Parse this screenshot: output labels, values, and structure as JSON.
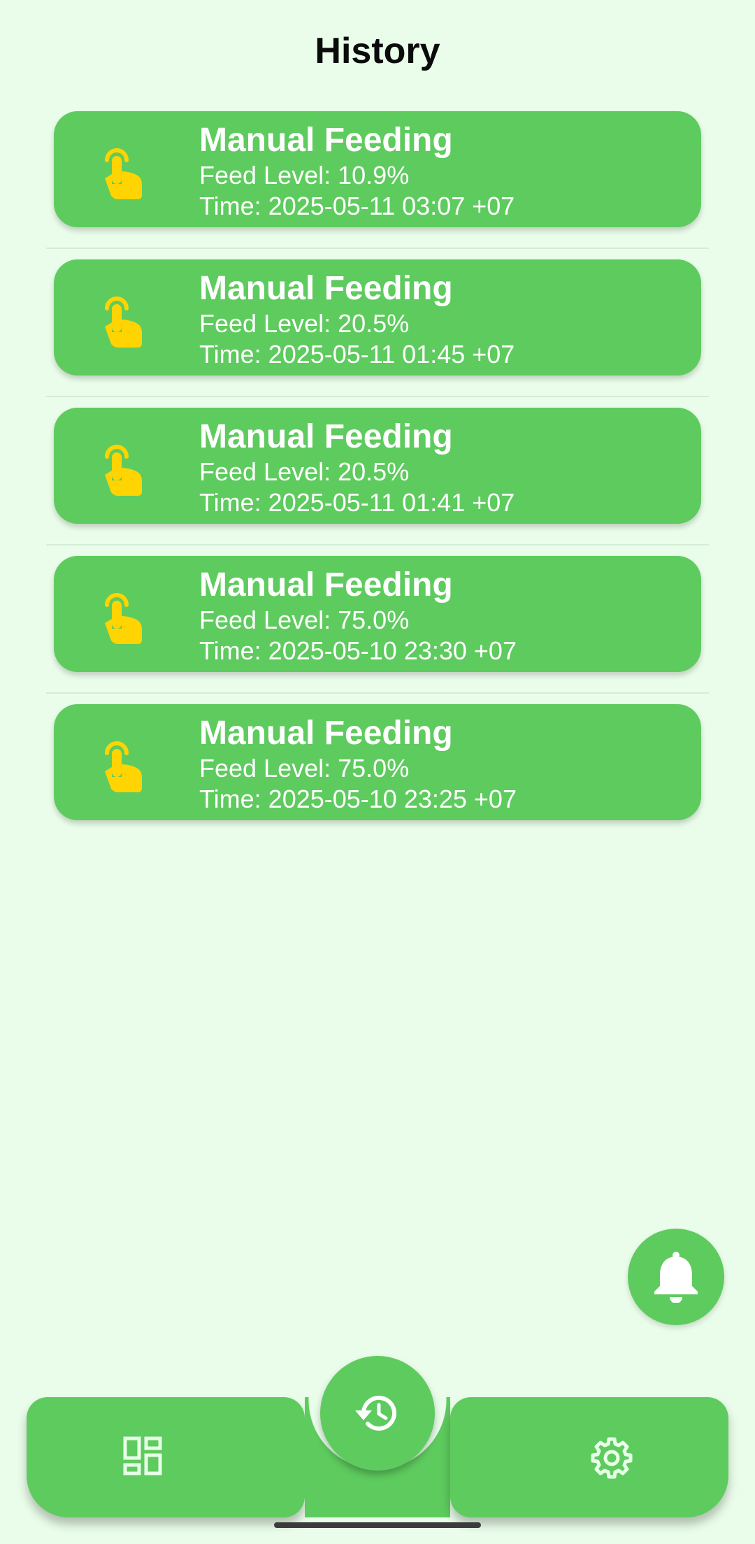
{
  "header": {
    "title": "History"
  },
  "history": {
    "items": [
      {
        "title": "Manual Feeding",
        "feed_level": "Feed Level: 10.9%",
        "time": "Time: 2025-05-11 03:07 +07"
      },
      {
        "title": "Manual Feeding",
        "feed_level": "Feed Level: 20.5%",
        "time": "Time: 2025-05-11 01:45 +07"
      },
      {
        "title": "Manual Feeding",
        "feed_level": "Feed Level: 20.5%",
        "time": "Time: 2025-05-11 01:41 +07"
      },
      {
        "title": "Manual Feeding",
        "feed_level": "Feed Level: 75.0%",
        "time": "Time: 2025-05-10 23:30 +07"
      },
      {
        "title": "Manual Feeding",
        "feed_level": "Feed Level: 75.0%",
        "time": "Time: 2025-05-10 23:25 +07"
      }
    ]
  },
  "icons": {
    "item_icon": "hand-pointer-icon",
    "notification": "bell-icon",
    "nav_left": "dashboard-icon",
    "nav_center": "history-icon",
    "nav_right": "gear-icon"
  },
  "colors": {
    "background": "#eafdea",
    "card": "#5ecb5e",
    "icon_yellow": "#ffd400",
    "text_on_card": "#ffffff"
  }
}
